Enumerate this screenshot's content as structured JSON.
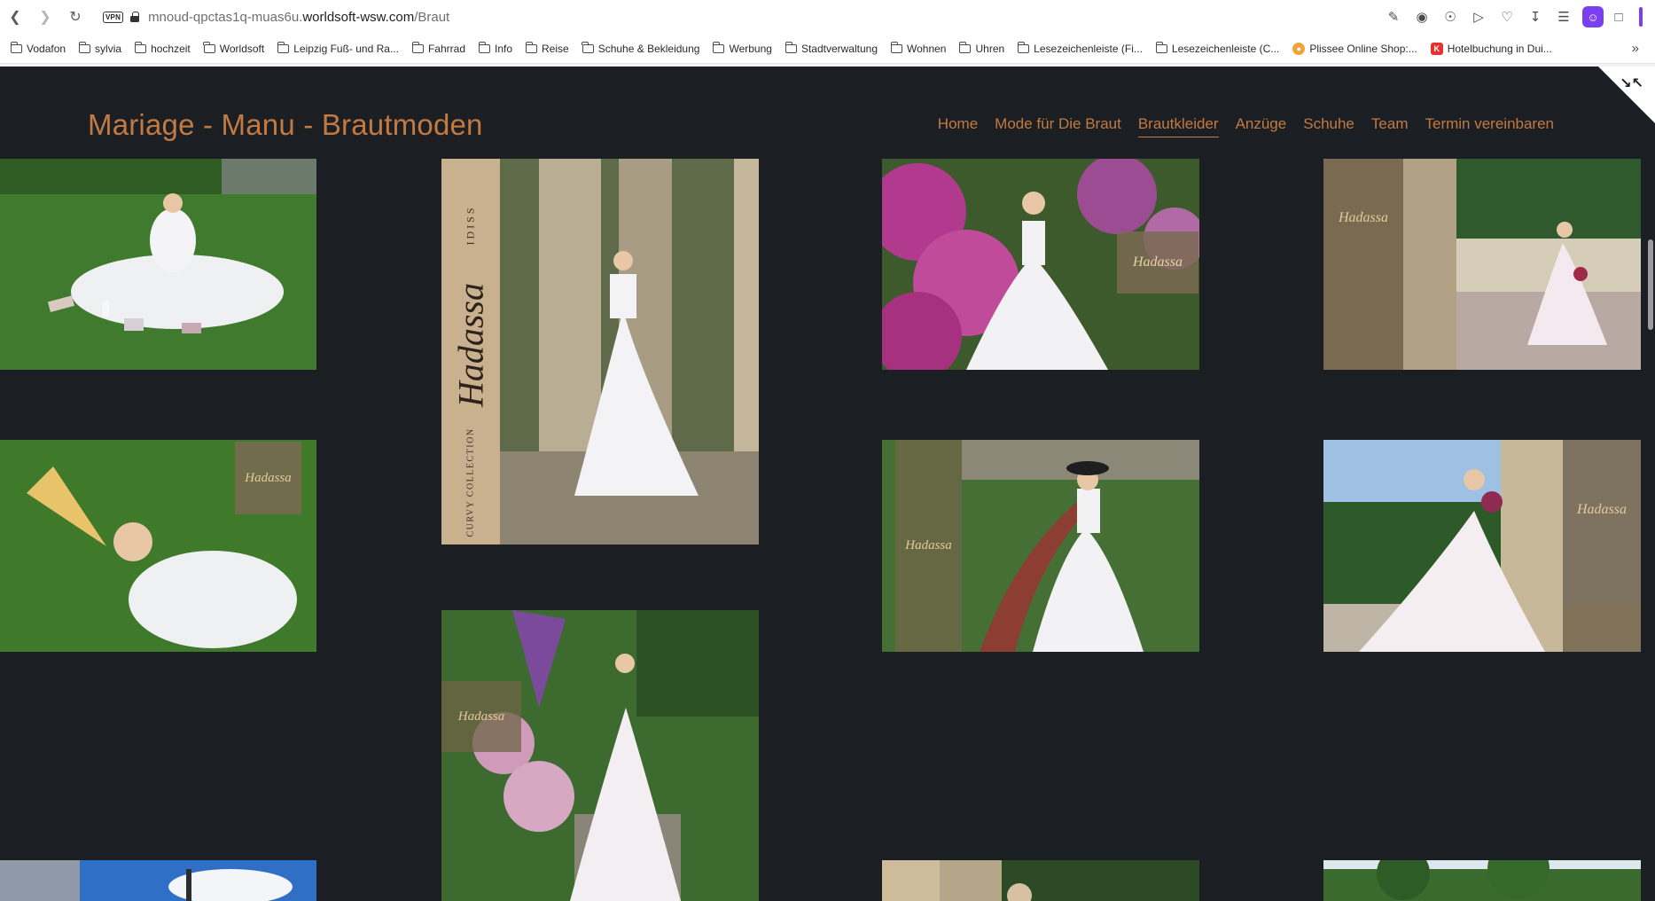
{
  "browser": {
    "url_prefix": "mnoud-qpctas1q-muas6u.",
    "url_domain": "worldsoft-wsw.com",
    "url_path": "/Braut",
    "vpn_label": "VPN",
    "bookmarks": [
      {
        "label": "Vodafon",
        "icon": "folder-icon"
      },
      {
        "label": "sylvia",
        "icon": "folder-icon"
      },
      {
        "label": "hochzeit",
        "icon": "folder-icon"
      },
      {
        "label": "Worldsoft",
        "icon": "folder-icon"
      },
      {
        "label": "Leipzig Fuß- und Ra...",
        "icon": "folder-icon"
      },
      {
        "label": "Fahrrad",
        "icon": "folder-icon"
      },
      {
        "label": "Info",
        "icon": "folder-icon"
      },
      {
        "label": "Reise",
        "icon": "folder-icon"
      },
      {
        "label": "Schuhe & Bekleidung",
        "icon": "folder-icon"
      },
      {
        "label": "Werbung",
        "icon": "folder-icon"
      },
      {
        "label": "Stadtverwaltung",
        "icon": "folder-icon"
      },
      {
        "label": "Wohnen",
        "icon": "folder-icon"
      },
      {
        "label": "Uhren",
        "icon": "folder-icon"
      },
      {
        "label": "Lesezeichenleiste (Fi...",
        "icon": "folder-icon"
      },
      {
        "label": "Lesezeichenleiste (C...",
        "icon": "folder-icon"
      },
      {
        "label": "Plissee Online Shop:...",
        "icon": "plissee-site-icon"
      },
      {
        "label": "Hotelbuchung in Dui...",
        "icon": "hotel-site-icon"
      }
    ],
    "hotel_icon_letter": "K"
  },
  "site": {
    "title": "Mariage - Manu - Brautmoden",
    "nav": [
      {
        "label": "Home"
      },
      {
        "label": "Mode für Die Braut"
      },
      {
        "label": "Brautkleider"
      },
      {
        "label": "Anzüge"
      },
      {
        "label": "Schuhe"
      },
      {
        "label": "Team"
      },
      {
        "label": "Termin vereinbaren"
      }
    ],
    "active_nav": "Brautkleider"
  },
  "gallery": {
    "photos": [
      {
        "name": "bride-on-lawn-photo"
      },
      {
        "name": "bride-ancient-columns-photo",
        "brand": "Hadassa",
        "banner_top": "IDISS",
        "banner_bottom": "CURVY COLLECTION"
      },
      {
        "name": "bride-purple-flowers-photo",
        "brand": "Hadassa"
      },
      {
        "name": "bride-balcony-balustrade-photo",
        "brand": "Hadassa"
      },
      {
        "name": "bride-lying-grass-photo",
        "brand": "Hadassa"
      },
      {
        "name": "bride-brick-path-photo",
        "brand": "Hadassa"
      },
      {
        "name": "bride-terrace-bouquet-photo",
        "brand": "Hadassa"
      },
      {
        "name": "bride-garden-stairs-photo",
        "brand": "Hadassa"
      },
      {
        "name": "bride-sky-photo-partial"
      },
      {
        "name": "bride-partial-photo-3"
      },
      {
        "name": "bride-partial-photo-4"
      }
    ]
  }
}
